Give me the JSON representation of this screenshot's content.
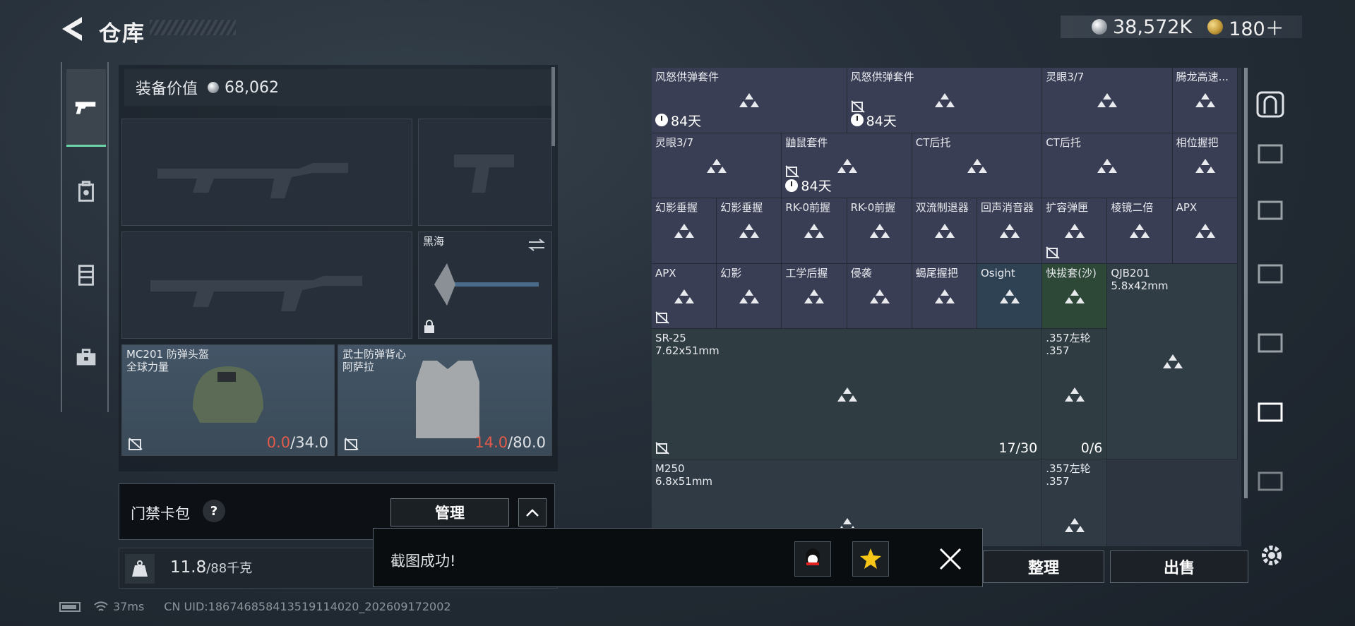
{
  "header": {
    "title": "仓库",
    "currency": {
      "silver": "38,572K",
      "gold": "180＋"
    }
  },
  "left": {
    "value_label": "装备价值",
    "value": "68,062",
    "melee": {
      "name": "黑海"
    },
    "helmet": {
      "name1": "MC201 防弹头盔",
      "name2": "全球力量",
      "dur_cur": "0.0",
      "dur_max": "/34.0"
    },
    "armor": {
      "name1": "武士防弹背心",
      "name2": "阿萨拉",
      "dur_cur": "14.0",
      "dur_max": "/80.0"
    },
    "access_label": "门禁卡包",
    "help": "?",
    "manage": "管理",
    "weight_val": "11.8",
    "weight_max": "/88千克"
  },
  "status": {
    "ping": "37ms",
    "uid": "CN UID:18674685841351911402​0_202609172002"
  },
  "grid": {
    "r1": [
      {
        "n": "风怒供弹套件",
        "t": "84天"
      },
      {
        "n": "风怒供弹套件",
        "t": "84天"
      },
      {
        "n": "灵眼3/7"
      },
      {
        "n": "腾龙高速..."
      }
    ],
    "r2": [
      {
        "n": "灵眼3/7"
      },
      {
        "n": "鼬鼠套件",
        "t": "84天"
      },
      {
        "n": "CT后托"
      },
      {
        "n": "CT后托"
      },
      {
        "n": "相位握把"
      }
    ],
    "r3": [
      {
        "n": "幻影垂握"
      },
      {
        "n": "幻影垂握"
      },
      {
        "n": "RK-0前握"
      },
      {
        "n": "RK-0前握"
      },
      {
        "n": "双流制退器"
      },
      {
        "n": "回声消音器"
      },
      {
        "n": "扩容弹匣"
      },
      {
        "n": "棱镜二倍"
      },
      {
        "n": "APX"
      }
    ],
    "r4": [
      {
        "n": "APX"
      },
      {
        "n": "幻影"
      },
      {
        "n": "工学后握"
      },
      {
        "n": "侵袭"
      },
      {
        "n": "蝎尾握把"
      },
      {
        "n": "Osight"
      },
      {
        "n": "快拔套(沙)"
      },
      {
        "n": "QJB201",
        "n2": "5.8x42mm"
      }
    ],
    "sr25": {
      "n": "SR-25",
      "n2": "7.62x51mm",
      "ammo": "17/30"
    },
    "r357a": {
      "n": ".357左轮",
      "n2": ".357",
      "ammo": "0/6"
    },
    "m250": {
      "n": "M250",
      "n2": "6.8x51mm"
    },
    "r357b": {
      "n": ".357左轮",
      "n2": ".357"
    }
  },
  "buttons": {
    "sort": "整理",
    "sell": "出售"
  },
  "toast": {
    "msg": "截图成功!"
  },
  "colors": {
    "accent": "#6dd3a9",
    "red": "#e25a4b",
    "cell": "#3a3e55"
  },
  "icons": [
    "pistol-icon",
    "backpack-icon",
    "vest-icon",
    "toolbox-icon",
    "safe-icon",
    "gear-icon",
    "close-icon",
    "qq-icon",
    "qzone-icon"
  ]
}
